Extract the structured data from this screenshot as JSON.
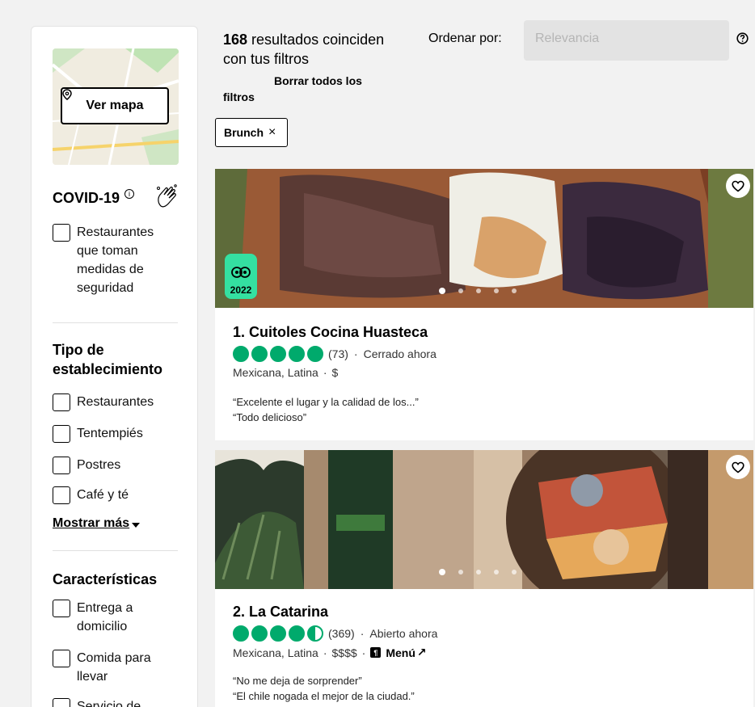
{
  "sidebar": {
    "map_button": "Ver mapa",
    "covid": {
      "title": "COVID-19",
      "info_icon": "info-icon",
      "icon": "hands-wash-icon",
      "option": "Restaurantes que toman medidas de seguridad"
    },
    "establishment": {
      "title": "Tipo de establecimiento",
      "options": [
        "Restaurantes",
        "Tentempiés",
        "Postres",
        "Café y té"
      ],
      "show_more": "Mostrar más"
    },
    "features": {
      "title": "Características",
      "options": [
        "Entrega a domicilio",
        "Comida para llevar",
        "Servicio de"
      ]
    }
  },
  "header": {
    "count": "168",
    "results_text": " resultados coinciden con tus filtros",
    "clear_all": "Borrar todos los filtros",
    "sort_label": "Ordenar por:",
    "sort_placeholder": "Relevancia",
    "help_icon": "help-icon"
  },
  "filters": [
    {
      "label": "Brunch"
    }
  ],
  "restaurants": [
    {
      "title": "1. Cuitoles Cocina Huasteca",
      "rating": 5,
      "reviews": "(73)",
      "status": "Cerrado ahora",
      "cuisine": "Mexicana, Latina",
      "price": "$",
      "award": "2022",
      "reviews_quotes": [
        "“Excelente el lugar y la calidad de los...”",
        "“Todo delicioso”"
      ]
    },
    {
      "title": "2. La Catarina",
      "rating": 4.5,
      "reviews": "(369)",
      "status": "Abierto ahora",
      "cuisine": "Mexicana, Latina",
      "price": "$$$$",
      "menu": "Menú",
      "reviews_quotes": [
        "“No me deja de sorprender”",
        "“El chile nogada el mejor de la ciudad.”"
      ]
    }
  ],
  "colors": {
    "accent_green": "#00aa6c",
    "award_green": "#34e0a1",
    "background": "#f2f2f2"
  }
}
